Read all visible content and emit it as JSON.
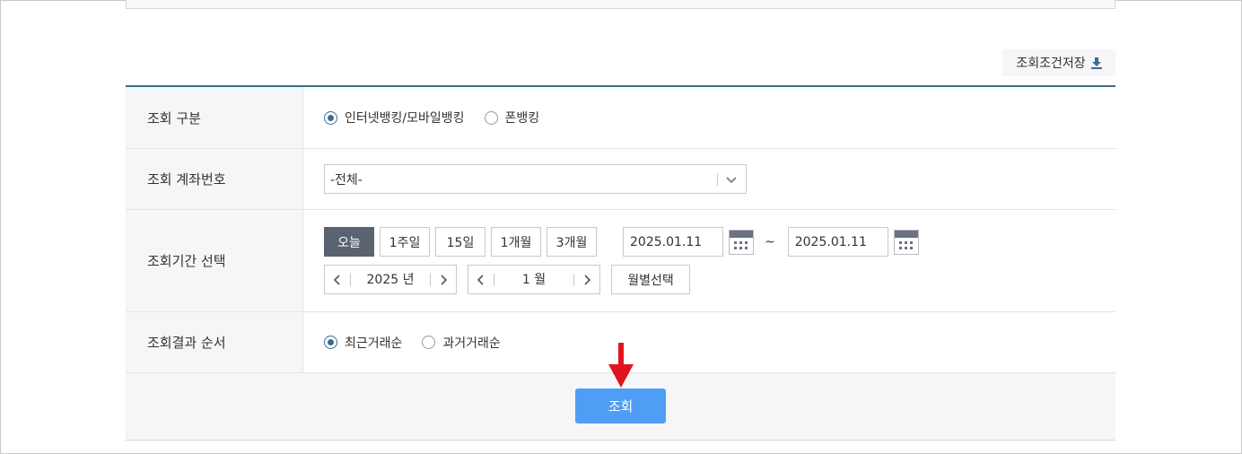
{
  "save_condition": {
    "label": "조회조건저장",
    "icon": "download-icon"
  },
  "form": {
    "type": {
      "label": "조회 구분",
      "options": [
        {
          "label": "인터넷뱅킹/모바일뱅킹",
          "checked": true
        },
        {
          "label": "폰뱅킹",
          "checked": false
        }
      ]
    },
    "account": {
      "label": "조회 계좌번호",
      "selected": "-전체-"
    },
    "period": {
      "label": "조회기간 선택",
      "quick": [
        "오늘",
        "1주일",
        "15일",
        "1개월",
        "3개월"
      ],
      "active_quick": "오늘",
      "start_date": "2025.01.11",
      "end_date": "2025.01.11",
      "tilde": "~",
      "year": "2025 년",
      "month": "1 월",
      "month_select_label": "월별선택"
    },
    "order": {
      "label": "조회결과 순서",
      "options": [
        {
          "label": "최근거래순",
          "checked": true
        },
        {
          "label": "과거거래순",
          "checked": false
        }
      ]
    }
  },
  "search_button": {
    "label": "조회"
  },
  "colors": {
    "accent": "#3a6e8f",
    "search_button": "#4f9ef5",
    "active_period": "#5b6370",
    "arrow": "#e0141e"
  }
}
